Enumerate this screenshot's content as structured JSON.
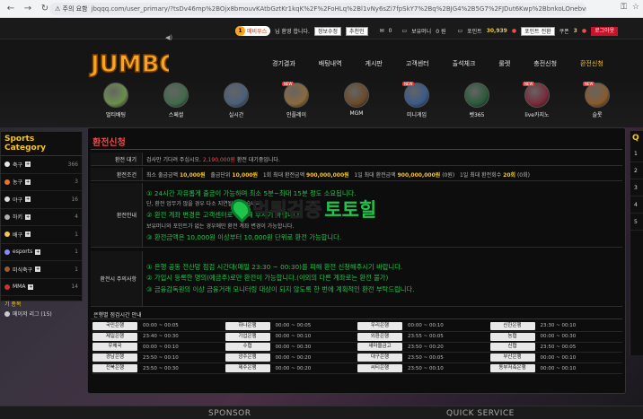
{
  "browser": {
    "warning": "⚠ 주의 요함",
    "url": "jbqqq.com/user_primary/?tsDv46mp%2BOjx8bmouvKAtbGztKr1kqK%2F%2FoHLq%2Bl1vNy6sZi7fpSkY7%2Bq%2BJG4%2B5G7%2FJDut6Kwp%2BbnkoLOnebvpuW11Oy7wsautrK0..."
  },
  "userbar": {
    "level": "1",
    "greeting_name": "매비우스",
    "greeting_suffix": "님 환영 합니다.",
    "info_btn": "정보수정",
    "attend_btn": "추천인",
    "mail_count": "0",
    "money_label": "보유머니",
    "money_value": "0 원",
    "point_label": "포인트",
    "point_value": "30,939",
    "point_convert_btn": "포인트 전환",
    "coupon_label": "쿠폰",
    "coupon_value": "3",
    "logout_btn": "로그아웃"
  },
  "logo_text": "JUMBO",
  "nav": [
    "경기결과",
    "배팅내역",
    "게시판",
    "고객센터",
    "출석체크",
    "룰렛",
    "충전신청",
    "환전신청"
  ],
  "games": [
    {
      "label": "멀티배팅",
      "color": "#6a8f4a"
    },
    {
      "label": "스페셜",
      "color": "#3f6a4a"
    },
    {
      "label": "실시간",
      "color": "#4a5f7a"
    },
    {
      "label": "인플레이",
      "color": "#8b6a3a",
      "new": "NEW"
    },
    {
      "label": "MGM",
      "color": "#6a4a2a"
    },
    {
      "label": "미니게임",
      "color": "#3a5a8a",
      "new": "NEW"
    },
    {
      "label": "벳365",
      "color": "#2a5a3a"
    },
    {
      "label": "live카지노",
      "color": "#7a2a3a",
      "new": "NEW"
    },
    {
      "label": "슬롯",
      "color": "#8a5a2a",
      "new": "NEW"
    }
  ],
  "sidebar": {
    "title": "Sports Category",
    "items": [
      {
        "label": "축구",
        "count": "366"
      },
      {
        "label": "농구",
        "count": "3"
      },
      {
        "label": "야구",
        "count": "16"
      },
      {
        "label": "하키",
        "count": "4"
      },
      {
        "label": "배구",
        "count": "1"
      },
      {
        "label": "esports",
        "count": "1"
      },
      {
        "label": "미식축구",
        "count": "1"
      },
      {
        "label": "MMA",
        "count": "14"
      }
    ],
    "sub_title": "기 종목",
    "sub_item": "메이저 리그 (15)"
  },
  "right_panel": {
    "title": "Q"
  },
  "page_title": "환전신청",
  "form": {
    "wait_label": "환전 대기",
    "wait_text_a": "검사만 기다려 주십시오.",
    "wait_amount": "2,190,000원",
    "wait_text_b": "환전 대기중입니다.",
    "cond_label": "환전조건",
    "cond_1a": "최소 출금금액",
    "cond_1b": "10,000원",
    "cond_2a": "출금단위",
    "cond_2b": "10,000원",
    "cond_3a": "1회 최대 환전금액",
    "cond_3b": "900,000,000원",
    "cond_4a": "1일 최대 환전금액",
    "cond_4b": "900,000,000원",
    "cond_4c": "(0원)",
    "cond_5a": "1일 최대 환전회수",
    "cond_5b": "20회",
    "cond_5c": "(0회)",
    "guide_label": "환전안내",
    "guide_lines": [
      "① 24시간 자유롭게 출금이 가능하며 최소 5분~최대 15분 정도 소요됩니다.",
      "단, 환전 업무가 많을 경우 다소 지연될 수 있습니다.",
      "② 환전 계좌 변경은 고객센터로 문의해 주시기 바랍니다.",
      "보유머니와 포인트가 없는 경우에만 환전 계좌 변경이 가능합니다.",
      "③ 환전금액은 10,000원 이상부터 10,000원 단위로 환전 가능합니다."
    ],
    "notice_label": "환전시 주의사항",
    "notice_lines": [
      "① 은행 공동 전산망 점검 시간대(매일 23:30 ~ 00:30)를 피해 환전 신청해주시기 바랍니다.",
      "② 가입시 등록한 명의(예금주)로만 환전이 가능합니다.(이외의 다른 계좌로는 환전 불가)",
      "③ 금융감독원의 이상 금융거래 모니터링 대상이 되지 않도록 한 번에 계획적인 환전 부탁드립니다."
    ]
  },
  "watermark": {
    "part1": "먹튀검증",
    "part2": "토토힐"
  },
  "schedule": {
    "title": "은행별 점검시간 안내",
    "rows": [
      [
        [
          "국민은행",
          "00:00 ~ 00:05"
        ],
        [
          "하나은행",
          "00:00 ~ 00:05"
        ],
        [
          "우리은행",
          "00:00 ~ 00:10"
        ],
        [
          "신한은행",
          "23:30 ~ 00:10"
        ]
      ],
      [
        [
          "제일은행",
          "23:40 ~ 00:30"
        ],
        [
          "기업은행",
          "00:00 ~ 00:10"
        ],
        [
          "외환은행",
          "23:55 ~ 00:05"
        ],
        [
          "농협",
          "00:00 ~ 00:30"
        ]
      ],
      [
        [
          "우체국",
          "00:00 ~ 00:10"
        ],
        [
          "수협",
          "00:00 ~ 00:30"
        ],
        [
          "새마을금고",
          "23:50 ~ 00:20"
        ],
        [
          "신협",
          "23:50 ~ 00:05"
        ]
      ],
      [
        [
          "경남은행",
          "23:50 ~ 00:10"
        ],
        [
          "광주은행",
          "00:00 ~ 00:20"
        ],
        [
          "대구은행",
          "23:50 ~ 00:05"
        ],
        [
          "부산은행",
          "00:00 ~ 00:10"
        ]
      ],
      [
        [
          "전북은행",
          "23:50 ~ 00:30"
        ],
        [
          "제주은행",
          "00:00 ~ 00:20"
        ],
        [
          "씨티은행",
          "23:50 ~ 00:10"
        ],
        [
          "동부저축은행",
          "00:00 ~ 00:10"
        ]
      ]
    ]
  },
  "footer": {
    "left": "SPONSOR",
    "right": "QUICK SERVICE"
  }
}
